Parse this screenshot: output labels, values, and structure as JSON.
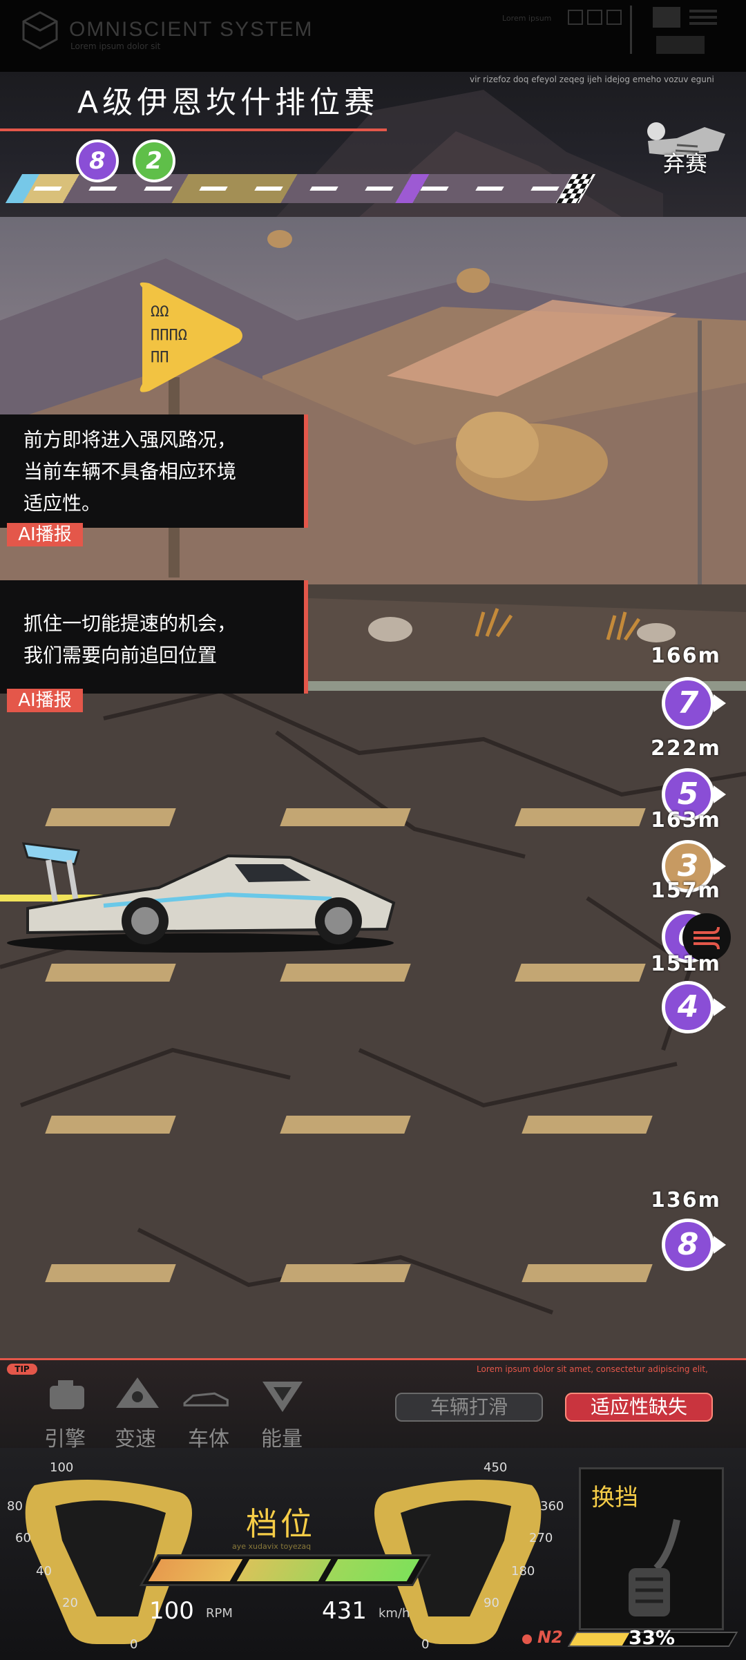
{
  "topbar": {
    "brand": "OMNISCIENT SYSTEM",
    "brand_sub": "Lorem ipsum dolor sit",
    "lorem": "Lorem ipsum"
  },
  "header": {
    "title": "A级伊恩坎什排位赛",
    "lorem": "vir rizefoz doq efeyol zeqeg ijeh idejog emeho vozuv eguni",
    "quit_label": "弃赛",
    "track_pins": [
      {
        "rank": "8",
        "color": "#8a4ed6"
      },
      {
        "rank": "2",
        "color": "#5fbf49"
      }
    ]
  },
  "ai_reports": [
    {
      "text": "前方即将进入强风路况，\n当前车辆不具备相应环境\n适应性。",
      "badge": "AI播报"
    },
    {
      "text": "抓住一切能提速的机会，\n我们需要向前追回位置",
      "badge": "AI播报"
    }
  ],
  "racers": [
    {
      "distance": "166m",
      "rank": "7",
      "color": "#8a4ed6"
    },
    {
      "distance": "222m",
      "rank": "5",
      "color": "#8a4ed6"
    },
    {
      "distance": "163m",
      "rank": "3",
      "color": "#c79a62"
    },
    {
      "distance": "157m",
      "rank": "6",
      "color": "#8a4ed6"
    },
    {
      "distance": "151m",
      "rank": "4",
      "color": "#8a4ed6"
    },
    {
      "distance": "136m",
      "rank": "8",
      "color": "#8a4ed6"
    }
  ],
  "bottom": {
    "tip_badge": "TIP",
    "tip_lorem": "Lorem ipsum dolor sit amet, consectetur adipiscing elit,",
    "systems": [
      {
        "label": "引擎",
        "icon": "engine-icon"
      },
      {
        "label": "变速",
        "icon": "gearbox-icon"
      },
      {
        "label": "车体",
        "icon": "car-body-icon"
      },
      {
        "label": "能量",
        "icon": "energy-icon"
      }
    ],
    "status_buttons": {
      "skid": "车辆打滑",
      "adapt": "适应性缺失"
    }
  },
  "dashboard": {
    "gear_label": "档位",
    "gear_sub": "aye xudavix toyezaq",
    "rpm_value": "100",
    "rpm_unit": "RPM",
    "speed_value": "431",
    "speed_unit": "km/h",
    "rpm_ticks": [
      "100",
      "80",
      "60",
      "40",
      "20",
      "0"
    ],
    "speed_ticks": [
      "450",
      "360",
      "270",
      "180",
      "90",
      "0"
    ],
    "shift_label": "换挡",
    "nitro_label": "N2",
    "nitro_percent": "33%",
    "nitro_fraction": 0.33
  }
}
